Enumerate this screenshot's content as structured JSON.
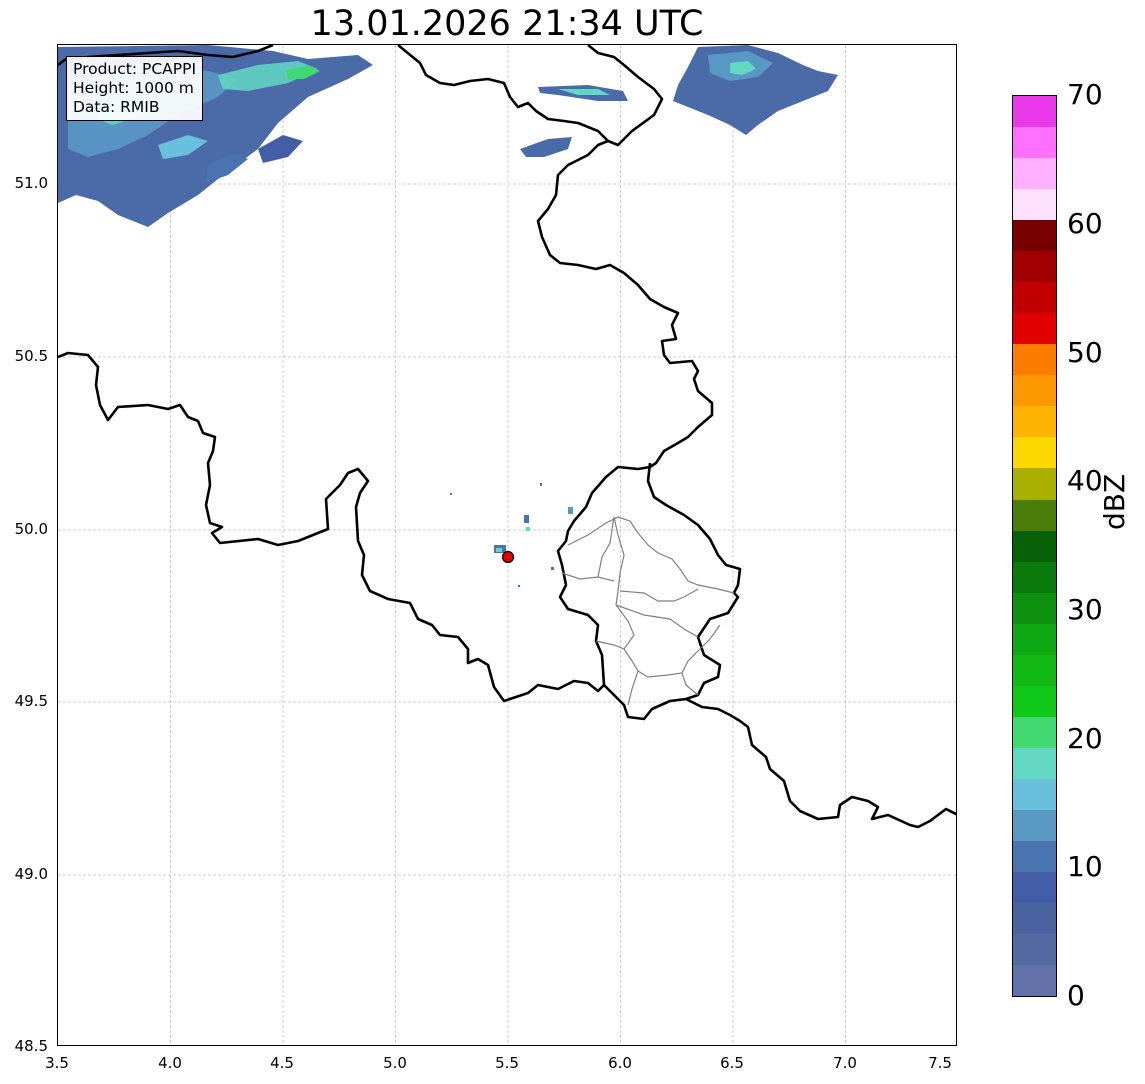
{
  "title": "13.01.2026 21:34 UTC",
  "info": {
    "product": "Product: PCAPPI",
    "height": "Height: 1000 m",
    "data": "Data: RMIB"
  },
  "axes": {
    "x_ticks": [
      "3.5",
      "4.0",
      "4.5",
      "5.0",
      "5.5",
      "6.0",
      "6.5",
      "7.0",
      "7.5"
    ],
    "y_ticks": [
      "51.0",
      "50.5",
      "50.0",
      "49.5",
      "49.0",
      "48.5"
    ],
    "x_range": [
      3.5,
      7.5
    ],
    "y_range": [
      48.5,
      51.4
    ],
    "grid": true
  },
  "radar_site": {
    "lon": 5.505,
    "lat": 49.915,
    "color": "#e00000"
  },
  "colorbar": {
    "label": "dBZ",
    "tick_labels": [
      "0",
      "10",
      "20",
      "30",
      "40",
      "50",
      "60",
      "70"
    ],
    "range": [
      0,
      70
    ],
    "colors": [
      "#6272a8",
      "#566aa2",
      "#4a62a0",
      "#435ea6",
      "#4a74b0",
      "#5a98c4",
      "#68c0dc",
      "#62d8c4",
      "#40d870",
      "#10c818",
      "#12b814",
      "#10a812",
      "#0e9010",
      "#0a7a0c",
      "#066008",
      "#4a7c08",
      "#aab000",
      "#fcd800",
      "#fcb400",
      "#fc9800",
      "#fc7c00",
      "#e00000",
      "#c00000",
      "#a00000",
      "#780000",
      "#ffe0ff",
      "#ffb0ff",
      "#ff70ff",
      "#e838e8"
    ]
  },
  "colors": {
    "border": "#000000",
    "province_border": "#808080",
    "grid": "#c0c0c0"
  }
}
